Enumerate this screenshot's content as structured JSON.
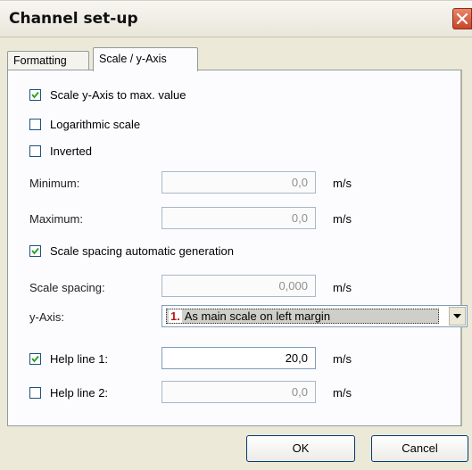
{
  "window": {
    "title": "Channel set-up"
  },
  "tabs": [
    {
      "label": "Formatting",
      "active": false
    },
    {
      "label": "Scale / y-Axis",
      "active": true
    }
  ],
  "checkboxes": {
    "scale_to_max": {
      "label": "Scale y-Axis to max. value",
      "checked": true
    },
    "logarithmic": {
      "label": "Logarithmic scale",
      "checked": false
    },
    "inverted": {
      "label": "Inverted",
      "checked": false
    },
    "auto_spacing": {
      "label": "Scale spacing automatic generation",
      "checked": true
    }
  },
  "fields": {
    "minimum": {
      "label": "Minimum:",
      "value": "0,0",
      "unit": "m/s",
      "enabled": false
    },
    "maximum": {
      "label": "Maximum:",
      "value": "0,0",
      "unit": "m/s",
      "enabled": false
    },
    "scale_spacing": {
      "label": "Scale spacing:",
      "value": "0,000",
      "unit": "m/s",
      "enabled": false
    },
    "help_line_1": {
      "label": "Help line 1:",
      "value": "20,0",
      "unit": "m/s",
      "checked": true,
      "enabled": true
    },
    "help_line_2": {
      "label": "Help line 2:",
      "value": "0,0",
      "unit": "m/s",
      "checked": false,
      "enabled": false
    }
  },
  "y_axis": {
    "label": "y-Axis:",
    "selected_number": "1.",
    "selected_text": "As main scale on left margin"
  },
  "buttons": {
    "ok": "OK",
    "cancel": "Cancel"
  },
  "icons": {
    "close": "close-icon",
    "checkmark": "check-icon",
    "dropdown": "chevron-down-icon"
  },
  "colors": {
    "close_button": "#c9452a",
    "badge_number": "#c0141a",
    "input_border": "#7f9db9"
  }
}
